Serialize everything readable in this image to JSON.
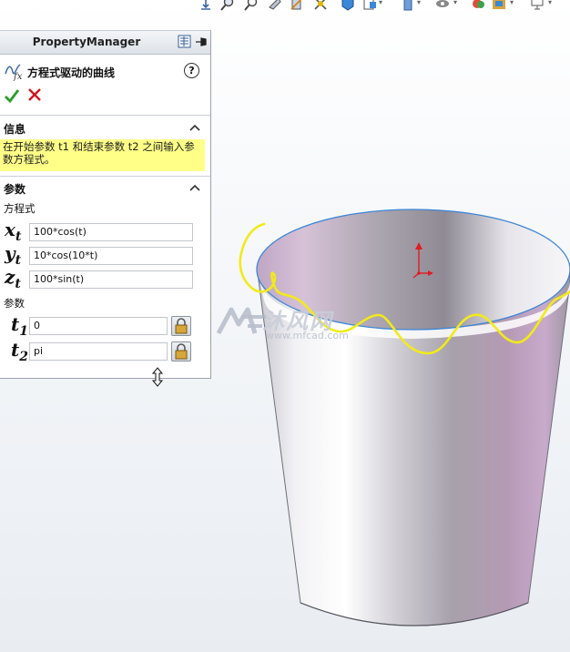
{
  "property_manager": {
    "title": "PropertyManager",
    "feature_name": "方程式驱动的曲线",
    "help_glyph": "?",
    "sections": {
      "info": {
        "title": "信息",
        "message": "在开始参数 t1 和结束参数 t2 之间输入参数方程式。"
      },
      "params": {
        "title": "参数",
        "equations_label": "方程式",
        "parameters_label": "参数"
      }
    },
    "equations": [
      {
        "var": "x",
        "sub": "t",
        "value": "100*cos(t)"
      },
      {
        "var": "y",
        "sub": "t",
        "value": "10*cos(10*t)"
      },
      {
        "var": "z",
        "sub": "t",
        "value": "100*sin(t)"
      }
    ],
    "parameters": [
      {
        "var": "t",
        "sub": "1",
        "value": "0"
      },
      {
        "var": "t",
        "sub": "2",
        "value": "pi"
      }
    ]
  },
  "watermark": {
    "text": "沐风网",
    "url": "www.mfcad.com"
  },
  "colors": {
    "ok": "#2a9d2a",
    "cancel": "#d0161d",
    "info_highlight": "#ffff88",
    "curve": "#f2ea19",
    "rim": "#3d86d6",
    "axis": "#e11b22"
  },
  "toolbar_icons": [
    "view-orientation-icon",
    "zoom-to-fit-icon",
    "zoom-area-icon",
    "previous-view-icon",
    "section-view-icon",
    "dynamic-annotation-icon",
    "display-style-icon",
    "hide-show-icon",
    "edit-appearance-icon",
    "scene-icon",
    "display-settings-icon"
  ]
}
